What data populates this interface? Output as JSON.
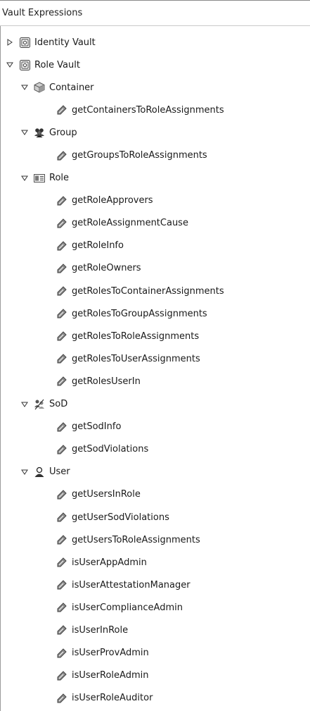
{
  "panel": {
    "title": "Vault Expressions"
  },
  "tree": {
    "identity_vault": {
      "label": "Identity Vault",
      "icon": "vault-icon",
      "expanded": false
    },
    "role_vault": {
      "label": "Role Vault",
      "icon": "vault-icon",
      "expanded": true
    },
    "container": {
      "label": "Container",
      "icon": "container-icon",
      "items": [
        "getContainersToRoleAssignments"
      ]
    },
    "group": {
      "label": "Group",
      "icon": "group-icon",
      "items": [
        "getGroupsToRoleAssignments"
      ]
    },
    "role": {
      "label": "Role",
      "icon": "role-icon",
      "items": [
        "getRoleApprovers",
        "getRoleAssignmentCause",
        "getRoleInfo",
        "getRoleOwners",
        "getRolesToContainerAssignments",
        "getRolesToGroupAssignments",
        "getRolesToRoleAssignments",
        "getRolesToUserAssignments",
        "getRolesUserIn"
      ]
    },
    "sod": {
      "label": "SoD",
      "icon": "sod-icon",
      "items": [
        "getSodInfo",
        "getSodViolations"
      ]
    },
    "user": {
      "label": "User",
      "icon": "user-icon",
      "items": [
        "getUsersInRole",
        "getUserSodViolations",
        "getUsersToRoleAssignments",
        "isUserAppAdmin",
        "isUserAttestationManager",
        "isUserComplianceAdmin",
        "isUserInRole",
        "isUserProvAdmin",
        "isUserRoleAdmin",
        "isUserRoleAuditor"
      ]
    }
  },
  "colors": {
    "leaf_icon": "#6b6b6b",
    "vault_icon": "#4a4a4a",
    "border": "#9a9a9a"
  }
}
